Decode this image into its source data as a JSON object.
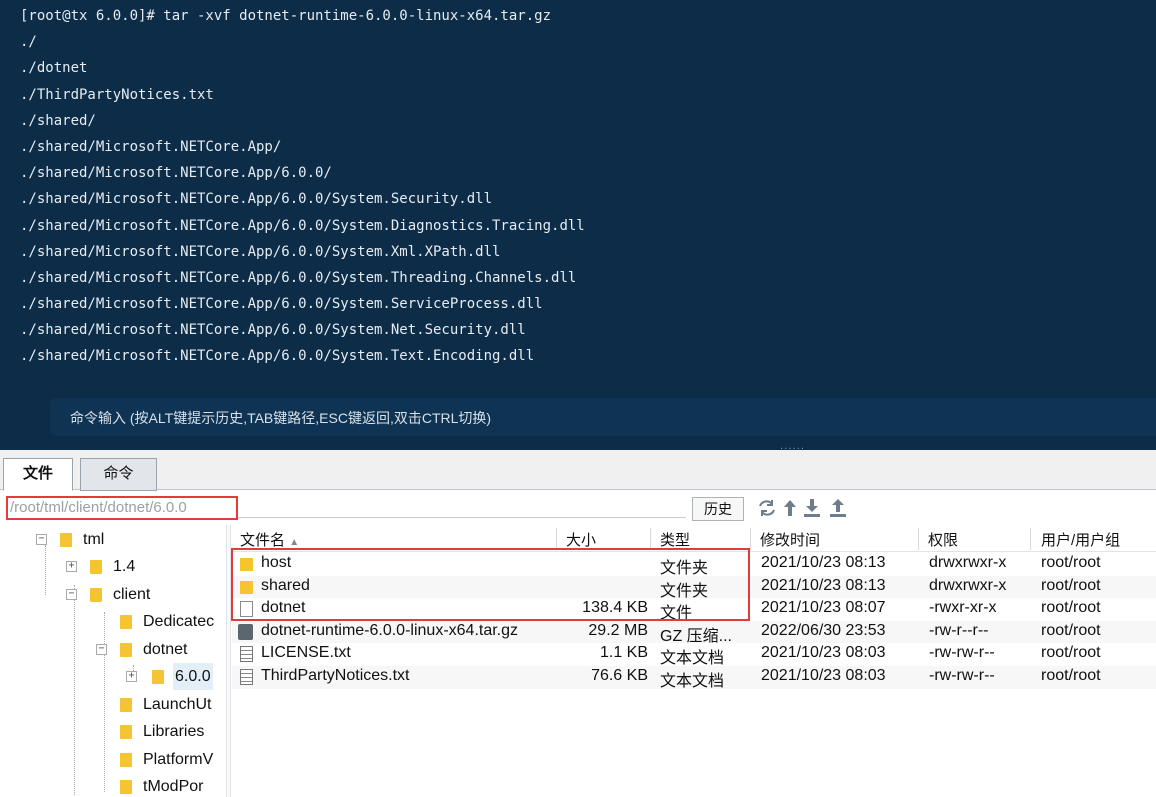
{
  "terminal": {
    "lines": [
      "[root@tx 6.0.0]# tar -xvf dotnet-runtime-6.0.0-linux-x64.tar.gz",
      "./",
      "./dotnet",
      "./ThirdPartyNotices.txt",
      "./shared/",
      "./shared/Microsoft.NETCore.App/",
      "./shared/Microsoft.NETCore.App/6.0.0/",
      "./shared/Microsoft.NETCore.App/6.0.0/System.Security.dll",
      "./shared/Microsoft.NETCore.App/6.0.0/System.Diagnostics.Tracing.dll",
      "./shared/Microsoft.NETCore.App/6.0.0/System.Xml.XPath.dll",
      "./shared/Microsoft.NETCore.App/6.0.0/System.Threading.Channels.dll",
      "./shared/Microsoft.NETCore.App/6.0.0/System.ServiceProcess.dll",
      "./shared/Microsoft.NETCore.App/6.0.0/System.Net.Security.dll",
      "./shared/Microsoft.NETCore.App/6.0.0/System.Text.Encoding.dll"
    ],
    "input_hint": "命令输入 (按ALT键提示历史,TAB键路径,ESC键返回,双击CTRL切换)",
    "background": "#0c2c48"
  },
  "tabs": [
    {
      "label": "文件",
      "active": true
    },
    {
      "label": "命令",
      "active": false
    }
  ],
  "pathbar": {
    "path": "/root/tml/client/dotnet/6.0.0",
    "history_label": "历史",
    "highlight_color": "#e23b3b"
  },
  "toolbar_icons": [
    "refresh-icon",
    "upload-arrow-icon",
    "download-icon",
    "upload-icon"
  ],
  "tree": {
    "items": [
      {
        "label": "tml",
        "expander": "−"
      },
      {
        "label": "1.4",
        "expander": "+"
      },
      {
        "label": "client",
        "expander": "−"
      },
      {
        "label": "Dedicatec"
      },
      {
        "label": "dotnet",
        "expander": "−"
      },
      {
        "label": "6.0.0",
        "expander": "+"
      },
      {
        "label": "LaunchUt"
      },
      {
        "label": "Libraries"
      },
      {
        "label": "PlatformV"
      },
      {
        "label": "tModPor"
      }
    ]
  },
  "filelist": {
    "columns": [
      "文件名",
      "大小",
      "类型",
      "修改时间",
      "权限",
      "用户/用户组"
    ],
    "sort_indicator": "▲",
    "rows": [
      {
        "name": "host",
        "size": "",
        "type": "文件夹",
        "mtime": "2021/10/23 08:13",
        "perm": "drwxrwxr-x",
        "owner": "root/root",
        "icon": "folder-icon"
      },
      {
        "name": "shared",
        "size": "",
        "type": "文件夹",
        "mtime": "2021/10/23 08:13",
        "perm": "drwxrwxr-x",
        "owner": "root/root",
        "icon": "folder-icon"
      },
      {
        "name": "dotnet",
        "size": "138.4 KB",
        "type": "文件",
        "mtime": "2021/10/23 08:07",
        "perm": "-rwxr-xr-x",
        "owner": "root/root",
        "icon": "file-icon"
      },
      {
        "name": "dotnet-runtime-6.0.0-linux-x64.tar.gz",
        "size": "29.2 MB",
        "type": "GZ 压缩...",
        "mtime": "2022/06/30 23:53",
        "perm": "-rw-r--r--",
        "owner": "root/root",
        "icon": "archive-icon"
      },
      {
        "name": "LICENSE.txt",
        "size": "1.1 KB",
        "type": "文本文档",
        "mtime": "2021/10/23 08:03",
        "perm": "-rw-rw-r--",
        "owner": "root/root",
        "icon": "text-file-icon"
      },
      {
        "name": "ThirdPartyNotices.txt",
        "size": "76.6 KB",
        "type": "文本文档",
        "mtime": "2021/10/23 08:03",
        "perm": "-rw-rw-r--",
        "owner": "root/root",
        "icon": "text-file-icon"
      }
    ]
  }
}
